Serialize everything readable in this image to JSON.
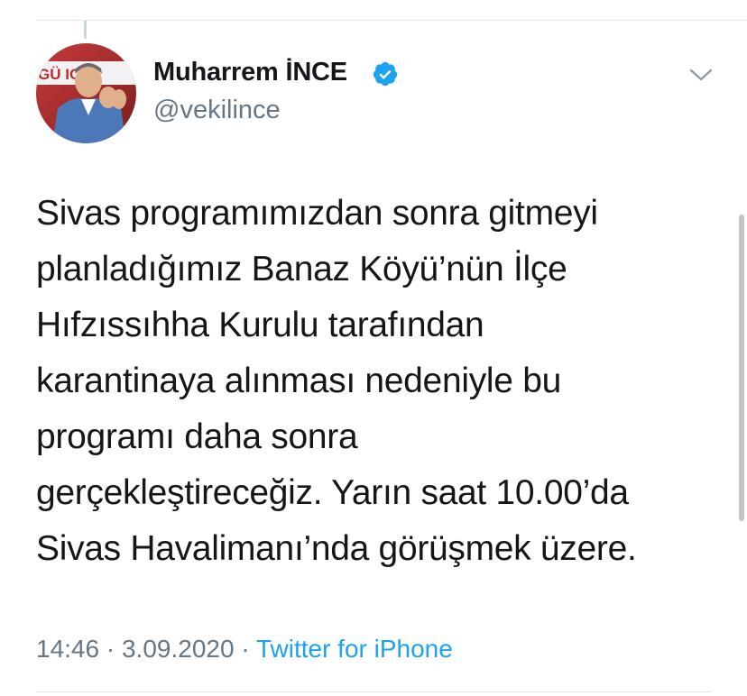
{
  "author": {
    "display_name": "Muharrem İNCE",
    "handle": "@vekilince",
    "verified": true,
    "avatar_banner_text": "GÜ  ICE"
  },
  "tweet": {
    "lines": [
      "Sivas programımızdan sonra gitmeyi",
      "planladığımız Banaz Köyü’nün İlçe",
      "Hıfzıssıhha Kurulu tarafından",
      "karantinaya alınması nedeniyle bu",
      "programı daha sonra",
      "gerçekleştireceğiz. Yarın saat 10.00’da",
      "Sivas Havalimanı’nda görüşmek üzere."
    ]
  },
  "meta": {
    "time": "14:46",
    "separator": "·",
    "date": "3.09.2020",
    "source": "Twitter for iPhone"
  },
  "colors": {
    "text": "#14171a",
    "secondary": "#657786",
    "accent": "#1da1f2",
    "divider": "#e1e8ed"
  },
  "icons": {
    "verified": "verified-badge-icon",
    "more": "chevron-down-icon"
  }
}
